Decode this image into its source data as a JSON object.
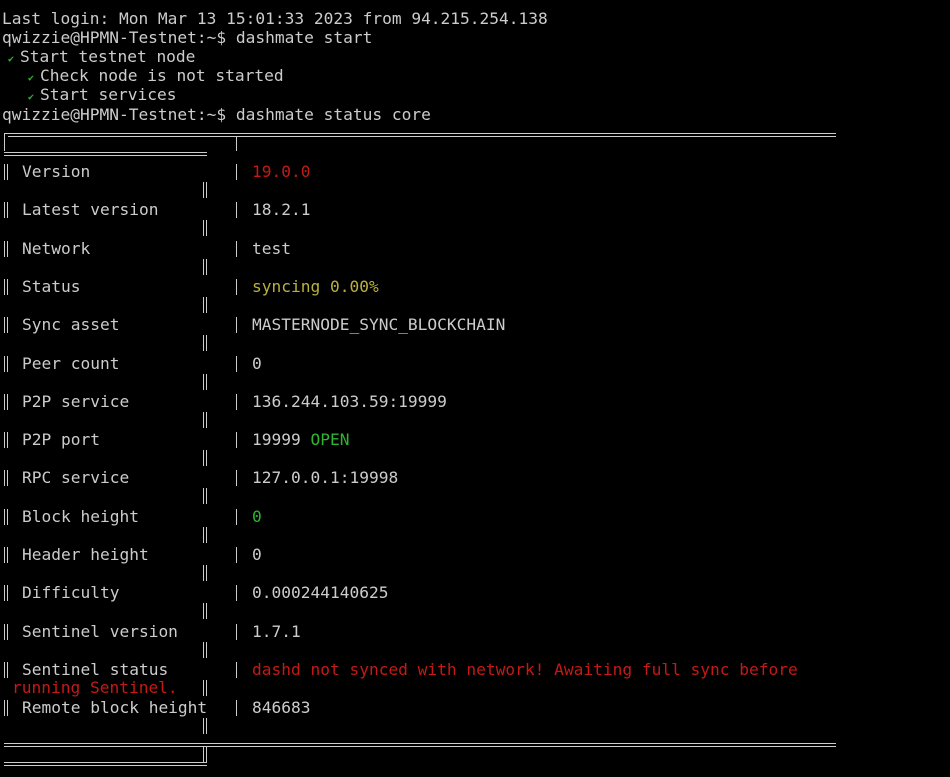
{
  "terminal": {
    "lines": {
      "last_login": "Last login: Mon Mar 13 15:01:33 2023 from 94.215.254.138",
      "prompt1": "qwizzie@HPMN-Testnet:~$ dashmate start",
      "task_start": "Start testnet node",
      "task_check": "Check node is not started",
      "task_services": "Start services",
      "prompt2": "qwizzie@HPMN-Testnet:~$ dashmate status core"
    },
    "check_glyph": "✔"
  },
  "status_table": {
    "rows": [
      {
        "label": "Version",
        "value": "19.0.0",
        "color": "#c41a16"
      },
      {
        "label": "Latest version",
        "value": "18.2.1"
      },
      {
        "label": "Network",
        "value": "test"
      },
      {
        "label": "Status",
        "value": "syncing 0.00%",
        "color": "#b8b23c"
      },
      {
        "label": "Sync asset",
        "value": "MASTERNODE_SYNC_BLOCKCHAIN"
      },
      {
        "label": "Peer count",
        "value": "0"
      },
      {
        "label": "P2P service",
        "value": "136.244.103.59:19999"
      },
      {
        "label": "P2P port",
        "value": "19999",
        "extra": "OPEN",
        "extra_color": "#2fb52f"
      },
      {
        "label": "RPC service",
        "value": "127.0.0.1:19998"
      },
      {
        "label": "Block height",
        "value": "0",
        "color": "#2fb52f"
      },
      {
        "label": "Header height",
        "value": "0"
      },
      {
        "label": "Difficulty",
        "value": "0.000244140625"
      },
      {
        "label": "Sentinel version",
        "value": "1.7.1"
      },
      {
        "label": "Sentinel status",
        "value": "dashd not synced with network! Awaiting full sync before",
        "color": "#c41a16"
      },
      {
        "label": "Remote block height",
        "value": "846683"
      }
    ],
    "sentinel_wrap": "running Sentinel."
  }
}
